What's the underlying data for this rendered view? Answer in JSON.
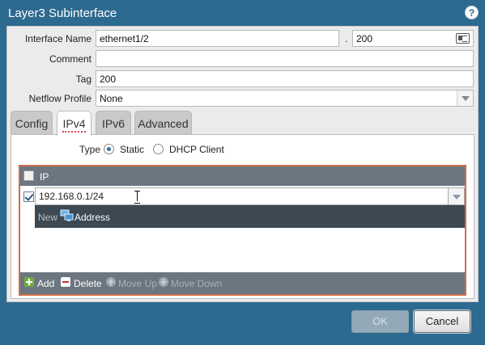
{
  "window": {
    "title": "Layer3 Subinterface",
    "help_icon": "?"
  },
  "form": {
    "interface_name_label": "Interface Name",
    "interface_name_value": "ethernet1/2",
    "separator": ".",
    "subinterface_value": "200",
    "comment_label": "Comment",
    "comment_value": "",
    "tag_label": "Tag",
    "tag_value": "200",
    "netflow_label": "Netflow Profile",
    "netflow_value": "None"
  },
  "tabs": [
    {
      "label": "Config",
      "active": false
    },
    {
      "label": "IPv4",
      "active": true
    },
    {
      "label": "IPv6",
      "active": false
    },
    {
      "label": "Advanced",
      "active": false
    }
  ],
  "ipv4": {
    "type_label": "Type",
    "options": [
      {
        "label": "Static",
        "selected": true
      },
      {
        "label": "DHCP Client",
        "selected": false
      }
    ],
    "grid": {
      "header": "IP",
      "rows": [
        {
          "checked": true,
          "value": "192.168.0.1/24"
        }
      ],
      "dropdown": {
        "new_label": "New",
        "item_label": "Address",
        "item_icon": "address-icon"
      },
      "footer": [
        {
          "label": "Add",
          "icon": "add-icon",
          "enabled": true
        },
        {
          "label": "Delete",
          "icon": "delete-icon",
          "enabled": true
        },
        {
          "label": "Move Up",
          "icon": "move-up-icon",
          "enabled": false
        },
        {
          "label": "Move Down",
          "icon": "move-down-icon",
          "enabled": false
        }
      ]
    }
  },
  "buttons": {
    "ok": "OK",
    "cancel": "Cancel"
  },
  "colors": {
    "accent": "#2d6a8f",
    "grid_header": "#6b7680",
    "focus_border": "#d06c4a",
    "dropdown_bg": "#3c4852"
  }
}
